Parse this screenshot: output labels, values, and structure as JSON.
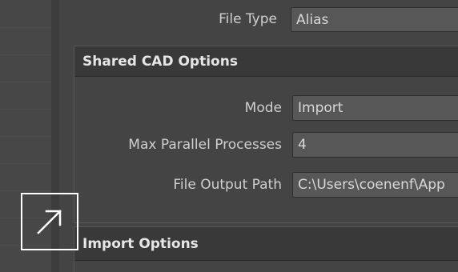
{
  "file_type": {
    "label": "File Type",
    "value": "Alias"
  },
  "shared_cad_options": {
    "title": "Shared CAD Options",
    "mode": {
      "label": "Mode",
      "value": "Import"
    },
    "max_parallel": {
      "label": "Max Parallel Processes",
      "value": "4"
    },
    "output_path": {
      "label": "File Output Path",
      "value": "C:\\Users\\coenenf\\App"
    }
  },
  "import_options": {
    "title": "Import Options"
  },
  "overlay": {
    "icon": "arrow-up-right-icon",
    "color": "#ffffff"
  }
}
